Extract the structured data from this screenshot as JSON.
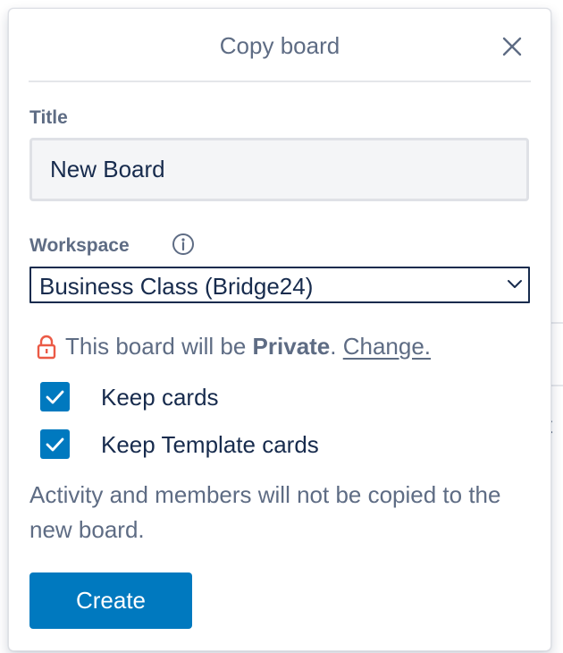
{
  "popover": {
    "title": "Copy board",
    "close_icon": "close-icon"
  },
  "title_field": {
    "label": "Title",
    "value": "New Board"
  },
  "workspace": {
    "label": "Workspace",
    "info_icon": "info-icon",
    "selected": "Business Class (Bridge24)",
    "chevron_icon": "chevron-down-icon"
  },
  "privacy": {
    "icon": "lock-icon",
    "prefix": "This board will be ",
    "level": "Private",
    "suffix": ". ",
    "change_link": "Change."
  },
  "options": [
    {
      "label": "Keep cards",
      "checked": true
    },
    {
      "label": "Keep Template cards",
      "checked": true
    }
  ],
  "note": "Activity and members will not be copied to the new board.",
  "create_button": "Create",
  "background": {
    "partial_text": "t"
  },
  "colors": {
    "accent": "#0079bf",
    "muted_text": "#5e6c84",
    "body_text": "#172b4d",
    "lock": "#eb5a46"
  }
}
